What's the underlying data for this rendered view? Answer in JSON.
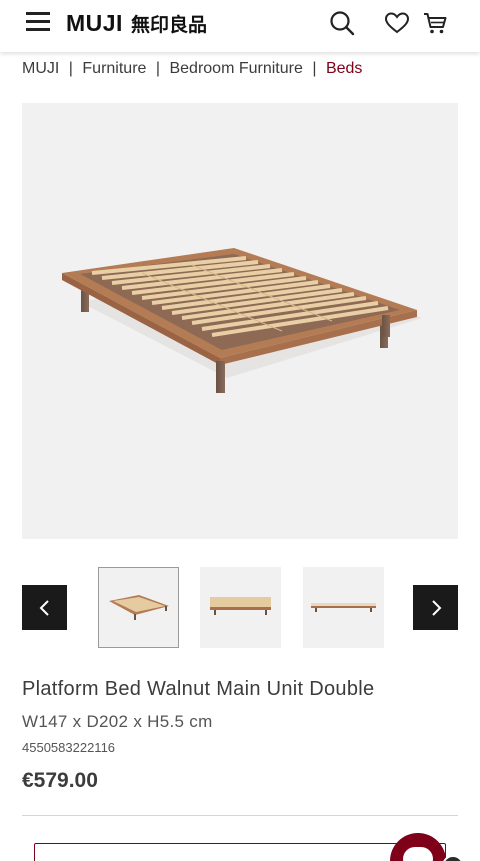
{
  "header": {
    "logo_en": "MUJI",
    "logo_jp": "無印良品",
    "menu_icon": "hamburger-menu-icon",
    "search_icon": "search-icon",
    "wishlist_icon": "heart-icon",
    "cart_icon": "cart-icon"
  },
  "breadcrumb": {
    "items": [
      "MUJI",
      "Furniture",
      "Bedroom Furniture",
      "Beds"
    ],
    "separator": "|"
  },
  "gallery": {
    "main_image": "platform-bed-walnut-product-photo",
    "thumbnails": [
      "bed-angle-view",
      "bed-front-view",
      "bed-side-view"
    ],
    "selected_index": 0,
    "prev_icon": "chevron-left-icon",
    "next_icon": "chevron-right-icon"
  },
  "product": {
    "title": "Platform Bed Walnut Main Unit Double",
    "dimensions": "W147 x D202 x H5.5 cm",
    "sku": "4550583222116",
    "price": "€579.00"
  },
  "colors": {
    "accent": "#7f0019",
    "text": "#3c3c3c",
    "arrow_bg": "#1a1a1a",
    "image_bg": "#f1f1f1"
  }
}
